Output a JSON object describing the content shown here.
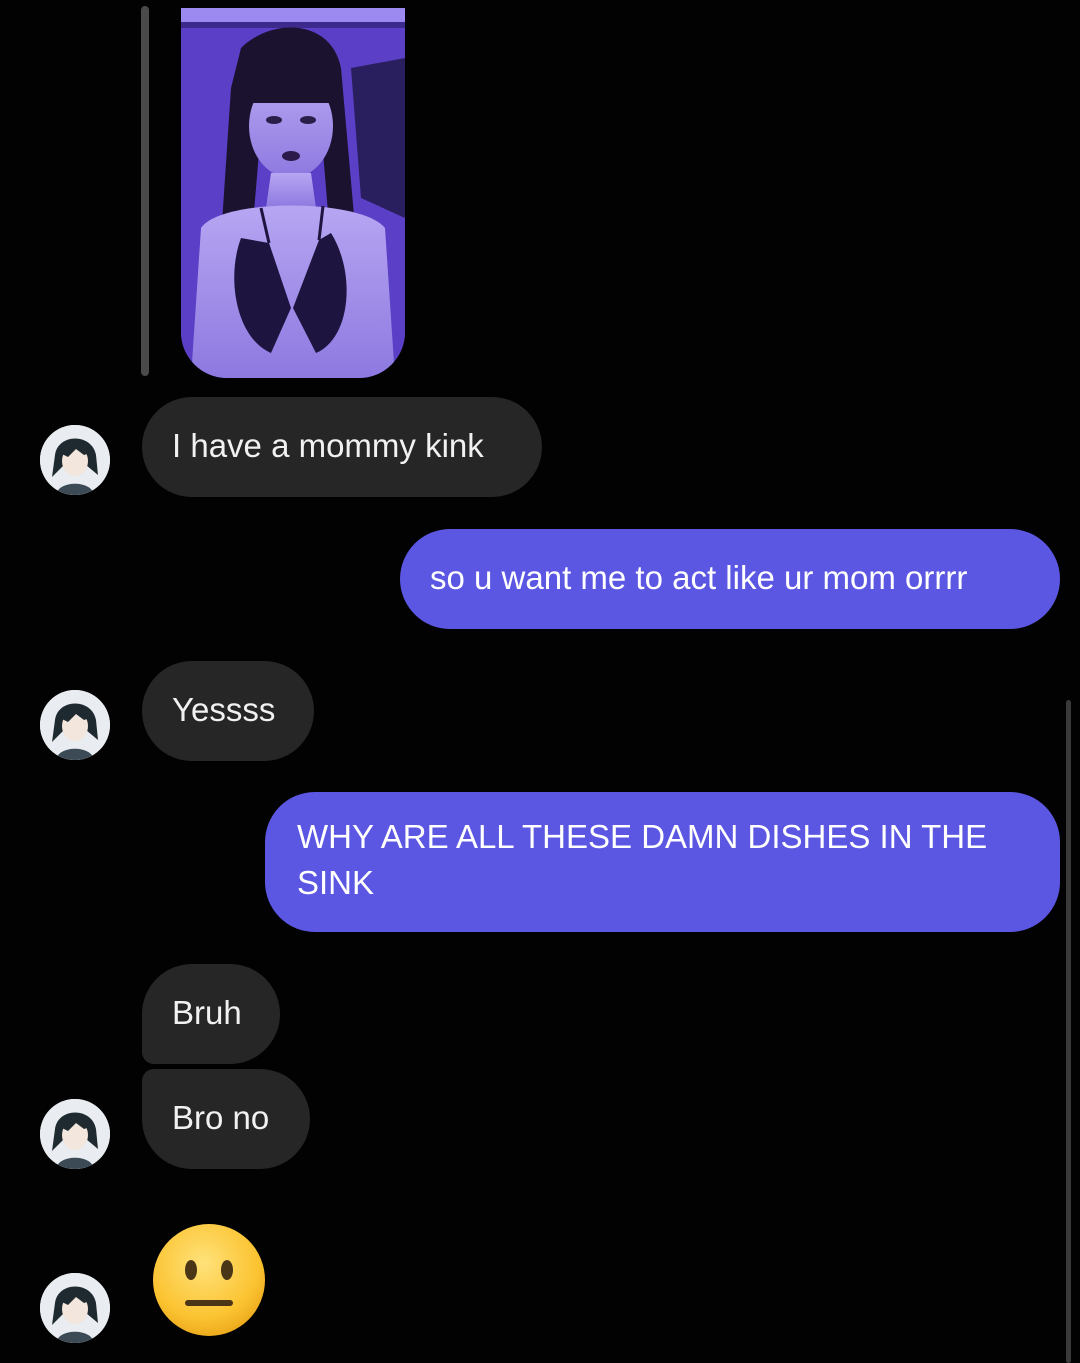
{
  "conversation": {
    "messages": [
      {
        "sender": "them",
        "text": "I have a mommy kink"
      },
      {
        "sender": "me",
        "text": "so u want me to act like ur mom orrrr"
      },
      {
        "sender": "them",
        "text": "Yessss"
      },
      {
        "sender": "me",
        "text": "WHY ARE ALL THESE DAMN DISHES IN THE SINK"
      },
      {
        "sender": "them",
        "text": "Bruh"
      },
      {
        "sender": "them",
        "text": "Bro no"
      }
    ],
    "emoji_reaction": "neutral-face-emoji",
    "shared_photo": "shared-photo"
  },
  "colors": {
    "background": "#020202",
    "incoming_bubble": "#262626",
    "outgoing_bubble": "#5b57e3",
    "text": "#f1f1f1"
  },
  "icons": {
    "avatar": "anime-character-avatar",
    "emoji": "neutral-face-emoji"
  }
}
